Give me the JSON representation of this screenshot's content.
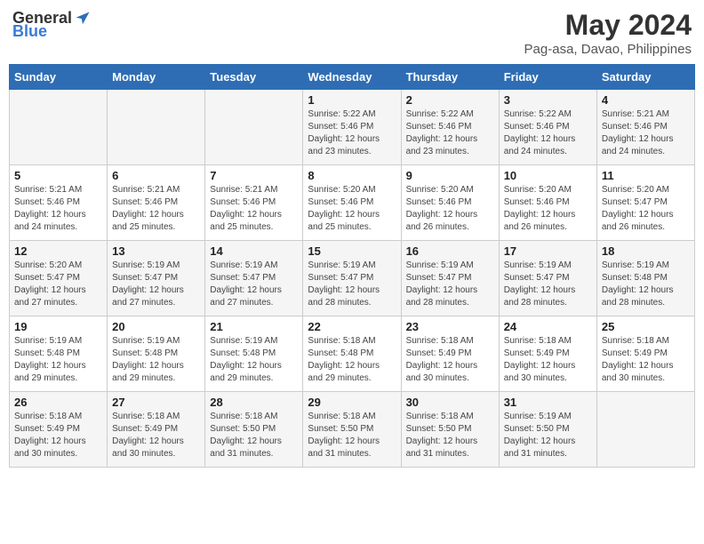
{
  "header": {
    "logo_general": "General",
    "logo_blue": "Blue",
    "month": "May 2024",
    "location": "Pag-asa, Davao, Philippines"
  },
  "weekdays": [
    "Sunday",
    "Monday",
    "Tuesday",
    "Wednesday",
    "Thursday",
    "Friday",
    "Saturday"
  ],
  "weeks": [
    [
      {
        "day": "",
        "info": ""
      },
      {
        "day": "",
        "info": ""
      },
      {
        "day": "",
        "info": ""
      },
      {
        "day": "1",
        "info": "Sunrise: 5:22 AM\nSunset: 5:46 PM\nDaylight: 12 hours\nand 23 minutes."
      },
      {
        "day": "2",
        "info": "Sunrise: 5:22 AM\nSunset: 5:46 PM\nDaylight: 12 hours\nand 23 minutes."
      },
      {
        "day": "3",
        "info": "Sunrise: 5:22 AM\nSunset: 5:46 PM\nDaylight: 12 hours\nand 24 minutes."
      },
      {
        "day": "4",
        "info": "Sunrise: 5:21 AM\nSunset: 5:46 PM\nDaylight: 12 hours\nand 24 minutes."
      }
    ],
    [
      {
        "day": "5",
        "info": "Sunrise: 5:21 AM\nSunset: 5:46 PM\nDaylight: 12 hours\nand 24 minutes."
      },
      {
        "day": "6",
        "info": "Sunrise: 5:21 AM\nSunset: 5:46 PM\nDaylight: 12 hours\nand 25 minutes."
      },
      {
        "day": "7",
        "info": "Sunrise: 5:21 AM\nSunset: 5:46 PM\nDaylight: 12 hours\nand 25 minutes."
      },
      {
        "day": "8",
        "info": "Sunrise: 5:20 AM\nSunset: 5:46 PM\nDaylight: 12 hours\nand 25 minutes."
      },
      {
        "day": "9",
        "info": "Sunrise: 5:20 AM\nSunset: 5:46 PM\nDaylight: 12 hours\nand 26 minutes."
      },
      {
        "day": "10",
        "info": "Sunrise: 5:20 AM\nSunset: 5:46 PM\nDaylight: 12 hours\nand 26 minutes."
      },
      {
        "day": "11",
        "info": "Sunrise: 5:20 AM\nSunset: 5:47 PM\nDaylight: 12 hours\nand 26 minutes."
      }
    ],
    [
      {
        "day": "12",
        "info": "Sunrise: 5:20 AM\nSunset: 5:47 PM\nDaylight: 12 hours\nand 27 minutes."
      },
      {
        "day": "13",
        "info": "Sunrise: 5:19 AM\nSunset: 5:47 PM\nDaylight: 12 hours\nand 27 minutes."
      },
      {
        "day": "14",
        "info": "Sunrise: 5:19 AM\nSunset: 5:47 PM\nDaylight: 12 hours\nand 27 minutes."
      },
      {
        "day": "15",
        "info": "Sunrise: 5:19 AM\nSunset: 5:47 PM\nDaylight: 12 hours\nand 28 minutes."
      },
      {
        "day": "16",
        "info": "Sunrise: 5:19 AM\nSunset: 5:47 PM\nDaylight: 12 hours\nand 28 minutes."
      },
      {
        "day": "17",
        "info": "Sunrise: 5:19 AM\nSunset: 5:47 PM\nDaylight: 12 hours\nand 28 minutes."
      },
      {
        "day": "18",
        "info": "Sunrise: 5:19 AM\nSunset: 5:48 PM\nDaylight: 12 hours\nand 28 minutes."
      }
    ],
    [
      {
        "day": "19",
        "info": "Sunrise: 5:19 AM\nSunset: 5:48 PM\nDaylight: 12 hours\nand 29 minutes."
      },
      {
        "day": "20",
        "info": "Sunrise: 5:19 AM\nSunset: 5:48 PM\nDaylight: 12 hours\nand 29 minutes."
      },
      {
        "day": "21",
        "info": "Sunrise: 5:19 AM\nSunset: 5:48 PM\nDaylight: 12 hours\nand 29 minutes."
      },
      {
        "day": "22",
        "info": "Sunrise: 5:18 AM\nSunset: 5:48 PM\nDaylight: 12 hours\nand 29 minutes."
      },
      {
        "day": "23",
        "info": "Sunrise: 5:18 AM\nSunset: 5:49 PM\nDaylight: 12 hours\nand 30 minutes."
      },
      {
        "day": "24",
        "info": "Sunrise: 5:18 AM\nSunset: 5:49 PM\nDaylight: 12 hours\nand 30 minutes."
      },
      {
        "day": "25",
        "info": "Sunrise: 5:18 AM\nSunset: 5:49 PM\nDaylight: 12 hours\nand 30 minutes."
      }
    ],
    [
      {
        "day": "26",
        "info": "Sunrise: 5:18 AM\nSunset: 5:49 PM\nDaylight: 12 hours\nand 30 minutes."
      },
      {
        "day": "27",
        "info": "Sunrise: 5:18 AM\nSunset: 5:49 PM\nDaylight: 12 hours\nand 30 minutes."
      },
      {
        "day": "28",
        "info": "Sunrise: 5:18 AM\nSunset: 5:50 PM\nDaylight: 12 hours\nand 31 minutes."
      },
      {
        "day": "29",
        "info": "Sunrise: 5:18 AM\nSunset: 5:50 PM\nDaylight: 12 hours\nand 31 minutes."
      },
      {
        "day": "30",
        "info": "Sunrise: 5:18 AM\nSunset: 5:50 PM\nDaylight: 12 hours\nand 31 minutes."
      },
      {
        "day": "31",
        "info": "Sunrise: 5:19 AM\nSunset: 5:50 PM\nDaylight: 12 hours\nand 31 minutes."
      },
      {
        "day": "",
        "info": ""
      }
    ]
  ]
}
